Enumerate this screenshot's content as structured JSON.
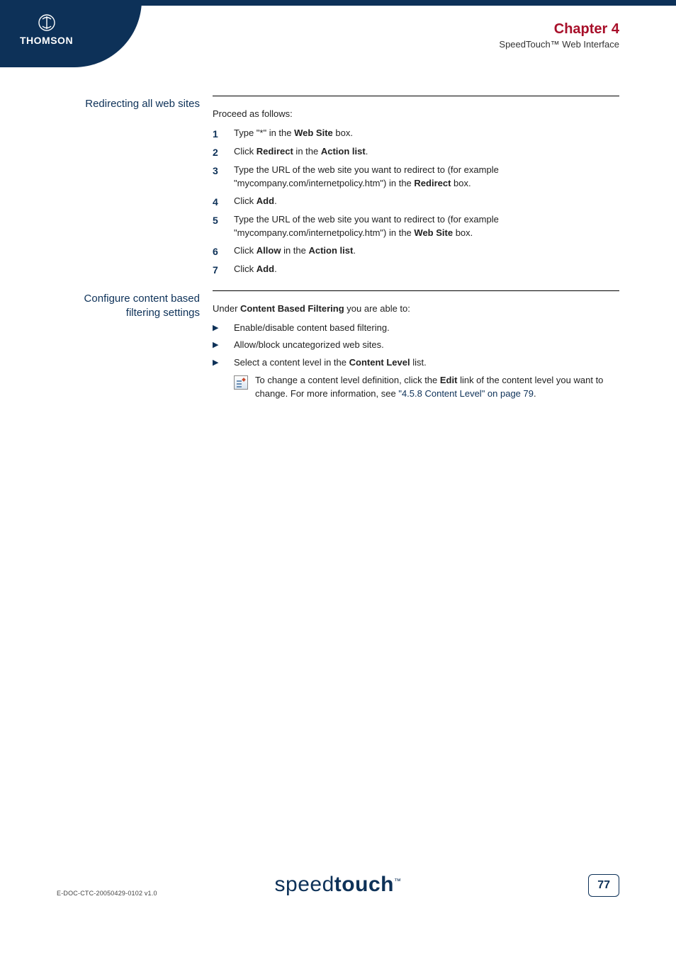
{
  "logo": {
    "name": "THOMSON"
  },
  "header": {
    "chapter": "Chapter 4",
    "subtitle": "SpeedTouch™ Web Interface"
  },
  "section1": {
    "label": "Redirecting all web sites",
    "intro": "Proceed as follows:",
    "steps": [
      {
        "num": "1",
        "parts": [
          "Type \"*\" in the ",
          "Web Site",
          " box."
        ]
      },
      {
        "num": "2",
        "parts": [
          "Click ",
          "Redirect",
          " in the ",
          "Action list",
          "."
        ]
      },
      {
        "num": "3",
        "parts": [
          "Type the URL of the web site you want to redirect to (for example \"mycompany.com/internetpolicy.htm\") in the ",
          "Redirect",
          " box."
        ]
      },
      {
        "num": "4",
        "parts": [
          "Click ",
          "Add",
          "."
        ]
      },
      {
        "num": "5",
        "parts": [
          "Type the URL of the web site you want to redirect to (for example \"mycompany.com/internetpolicy.htm\") in the ",
          "Web Site",
          " box."
        ]
      },
      {
        "num": "6",
        "parts": [
          "Click ",
          "Allow",
          " in the ",
          "Action list",
          "."
        ]
      },
      {
        "num": "7",
        "parts": [
          "Click ",
          "Add",
          "."
        ]
      }
    ]
  },
  "section2": {
    "label": "Configure content based filtering settings",
    "intro_pre": "Under ",
    "intro_bold": "Content Based Filtering",
    "intro_post": " you are able to:",
    "bullets": [
      {
        "text": "Enable/disable content based filtering."
      },
      {
        "text": "Allow/block uncategorized web sites."
      },
      {
        "pre": "Select a content level in the ",
        "bold": "Content Level",
        "post": " list."
      }
    ],
    "note": {
      "pre": "To change a content level definition, click the ",
      "bold": "Edit",
      "mid": " link of the content level you want to change. For more information, see ",
      "link": "\"4.5.8 Content Level\" on page 79",
      "post": "."
    }
  },
  "footer": {
    "docref": "E-DOC-CTC-20050429-0102 v1.0",
    "brand_light": "speed",
    "brand_bold": "touch",
    "brand_tm": "™",
    "page": "77"
  }
}
